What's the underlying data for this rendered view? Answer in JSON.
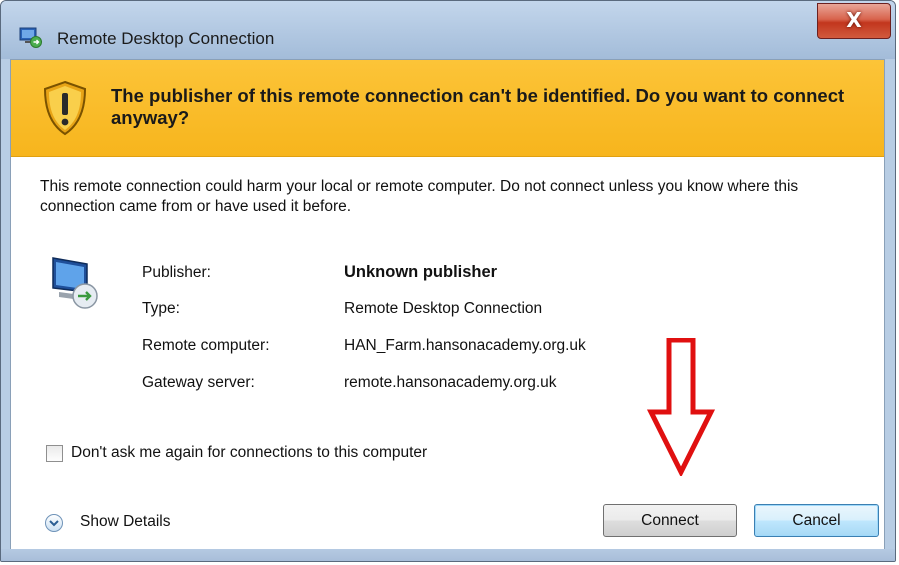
{
  "window": {
    "title": "Remote Desktop Connection",
    "close_glyph": "X"
  },
  "warning": {
    "icon": "shield-warning-icon",
    "text": "The publisher of this remote connection can't be identified. Do you want to connect anyway?"
  },
  "description": "This remote connection could harm your local or remote computer. Do not connect unless you know where this connection came from or have used it before.",
  "details": {
    "icon": "remote-computer-icon",
    "rows": [
      {
        "label": "Publisher:",
        "value": "Unknown publisher"
      },
      {
        "label": "Type:",
        "value": "Remote Desktop Connection"
      },
      {
        "label": "Remote computer:",
        "value": "HAN_Farm.hansonacademy.org.uk"
      },
      {
        "label": "Gateway server:",
        "value": "remote.hansonacademy.org.uk"
      }
    ]
  },
  "checkbox": {
    "label": "Don't ask me again for connections to this computer",
    "checked": false
  },
  "show_details": {
    "label": "Show Details",
    "icon": "chevron-down-circle-icon"
  },
  "buttons": {
    "connect": "Connect",
    "cancel": "Cancel"
  },
  "annotation": {
    "arrow_color": "#e01010"
  }
}
